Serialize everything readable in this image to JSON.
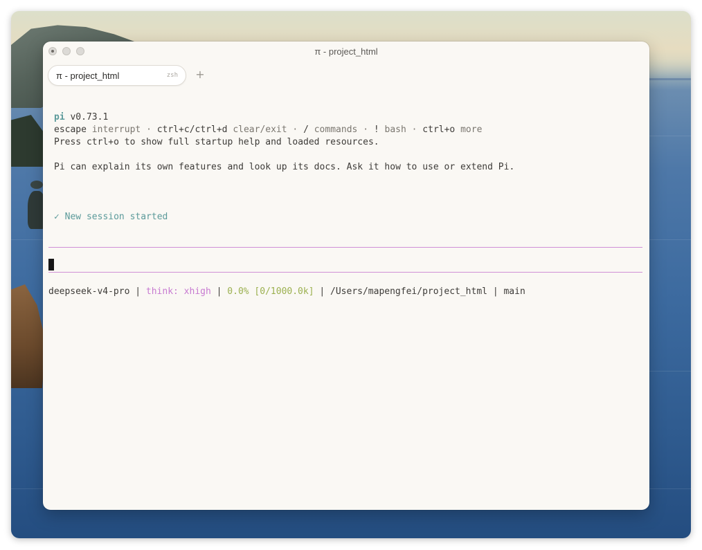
{
  "window": {
    "title": "π - project_html",
    "tab": {
      "label": "π - project_html",
      "shell": "zsh"
    },
    "new_tab_glyph": "+"
  },
  "terminal": {
    "header": {
      "app": "pi",
      "version": "v0.73.1"
    },
    "keys_line": [
      {
        "key": "escape",
        "desc": "interrupt"
      },
      {
        "key": "ctrl+c/ctrl+d",
        "desc": "clear/exit"
      },
      {
        "key": "/",
        "desc": "commands"
      },
      {
        "key": "!",
        "desc": "bash"
      },
      {
        "key": "ctrl+o",
        "desc": "more"
      }
    ],
    "separator": "·",
    "startup_hint": "Press ctrl+o to show full startup help and loaded resources.",
    "intro": "Pi can explain its own features and look up its docs. Ask it how to use or extend Pi.",
    "session_check": "✓",
    "session_status": "New session started",
    "status_bar": {
      "model": "deepseek-v4-pro",
      "divider": "|",
      "think": "think: xhigh",
      "context": "0.0% [0/1000.0k]",
      "path": "/Users/mapengfei/project_html",
      "branch": "main"
    }
  },
  "colors": {
    "accent_teal": "#5b9a9a",
    "accent_magenta": "#c77ad1",
    "accent_green": "#9bb04f",
    "rule_color": "#cf8fd6",
    "background": "#faf8f4"
  }
}
